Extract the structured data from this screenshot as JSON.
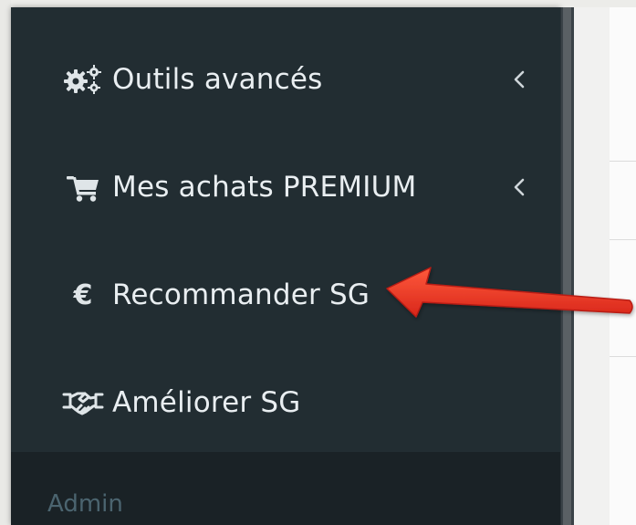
{
  "sidebar": {
    "items": [
      {
        "label": "Outils avancés",
        "icon": "gears-icon",
        "has_submenu": true
      },
      {
        "label": "Mes achats PREMIUM",
        "icon": "shopping-cart-icon",
        "has_submenu": true
      },
      {
        "label": "Recommander SG",
        "icon": "euro-icon",
        "has_submenu": false,
        "icon_glyph": "€"
      },
      {
        "label": "Améliorer SG",
        "icon": "handshake-icon",
        "has_submenu": false
      }
    ],
    "section_header": "Admin"
  },
  "colors": {
    "sidebar_bg": "#222d32",
    "header_bg": "#1a2226",
    "header_text": "#4b646f",
    "item_text": "#e9eef1",
    "annotation_arrow": "#e8321e"
  },
  "annotation": {
    "type": "arrow",
    "points_to": "sidebar-item-recommander-sg"
  }
}
